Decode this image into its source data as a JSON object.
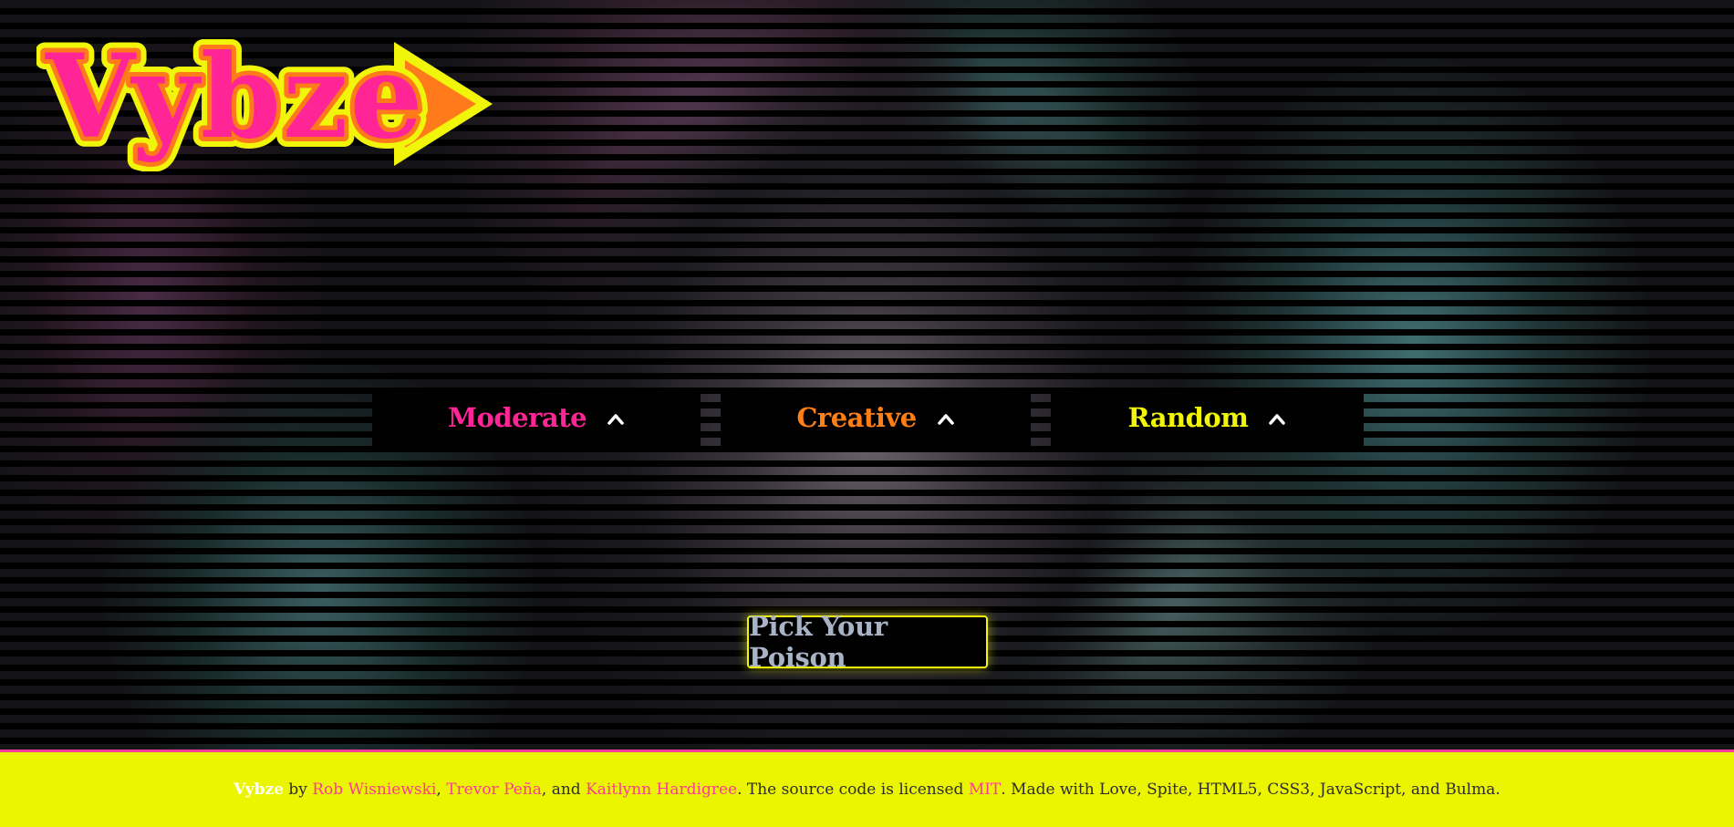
{
  "logo": {
    "text": "Vybze",
    "colors": {
      "fill": "#ff2596",
      "inner_stroke": "#ff7a1a",
      "outer_stroke": "#f1f50a"
    }
  },
  "dropdowns": [
    {
      "label": "Moderate",
      "color": "#ff2596",
      "icon": "chevron-up-icon"
    },
    {
      "label": "Creative",
      "color": "#ff7f16",
      "icon": "chevron-up-icon"
    },
    {
      "label": "Random",
      "color": "#f1f50a",
      "icon": "chevron-up-icon"
    }
  ],
  "action": {
    "label": "Pick Your Poison",
    "border_color": "#f1f50a"
  },
  "footer": {
    "brand": "Vybze",
    "by": " by ",
    "authors": [
      "Rob Wisniewski",
      "Trevor Peña",
      "Kaitlynn Hardigree"
    ],
    "sep1": ", ",
    "sep2": ", and ",
    "license_text": ". The source code is licensed ",
    "license": "MIT",
    "tail": ". Made with Love, Spite, HTML5, CSS3, JavaScript, and Bulma.",
    "background": "#ecf500",
    "link_color": "#ff3a95"
  }
}
